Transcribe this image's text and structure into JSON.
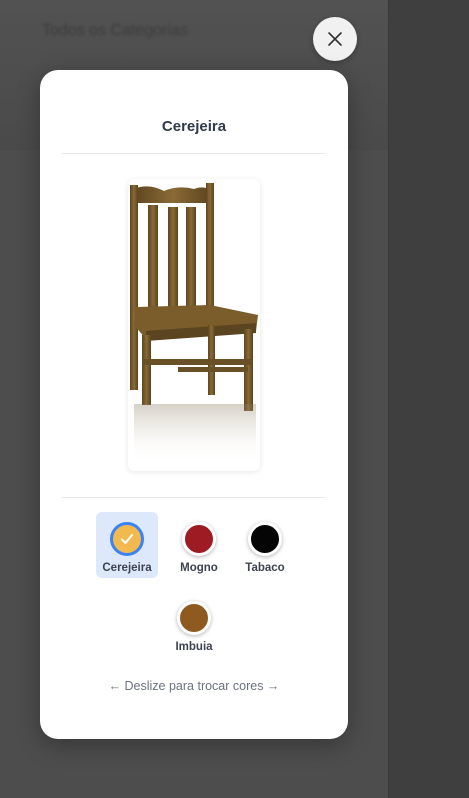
{
  "background": {
    "title": "Todos os Categorias"
  },
  "modal": {
    "title": "Cerejeira",
    "selected_color": "Cerejeira",
    "colors": [
      {
        "label": "Cerejeira",
        "hex": "#f2b94e",
        "selected": true
      },
      {
        "label": "Mogno",
        "hex": "#9f1b24",
        "selected": false
      },
      {
        "label": "Tabaco",
        "hex": "#050505",
        "selected": false
      },
      {
        "label": "Imbuia",
        "hex": "#8e5a1f",
        "selected": false
      }
    ],
    "swipe_hint": "← Deslize para trocar cores →"
  },
  "icons": {
    "close": "close-icon",
    "check": "check-icon"
  },
  "accent": "#3b82f6"
}
